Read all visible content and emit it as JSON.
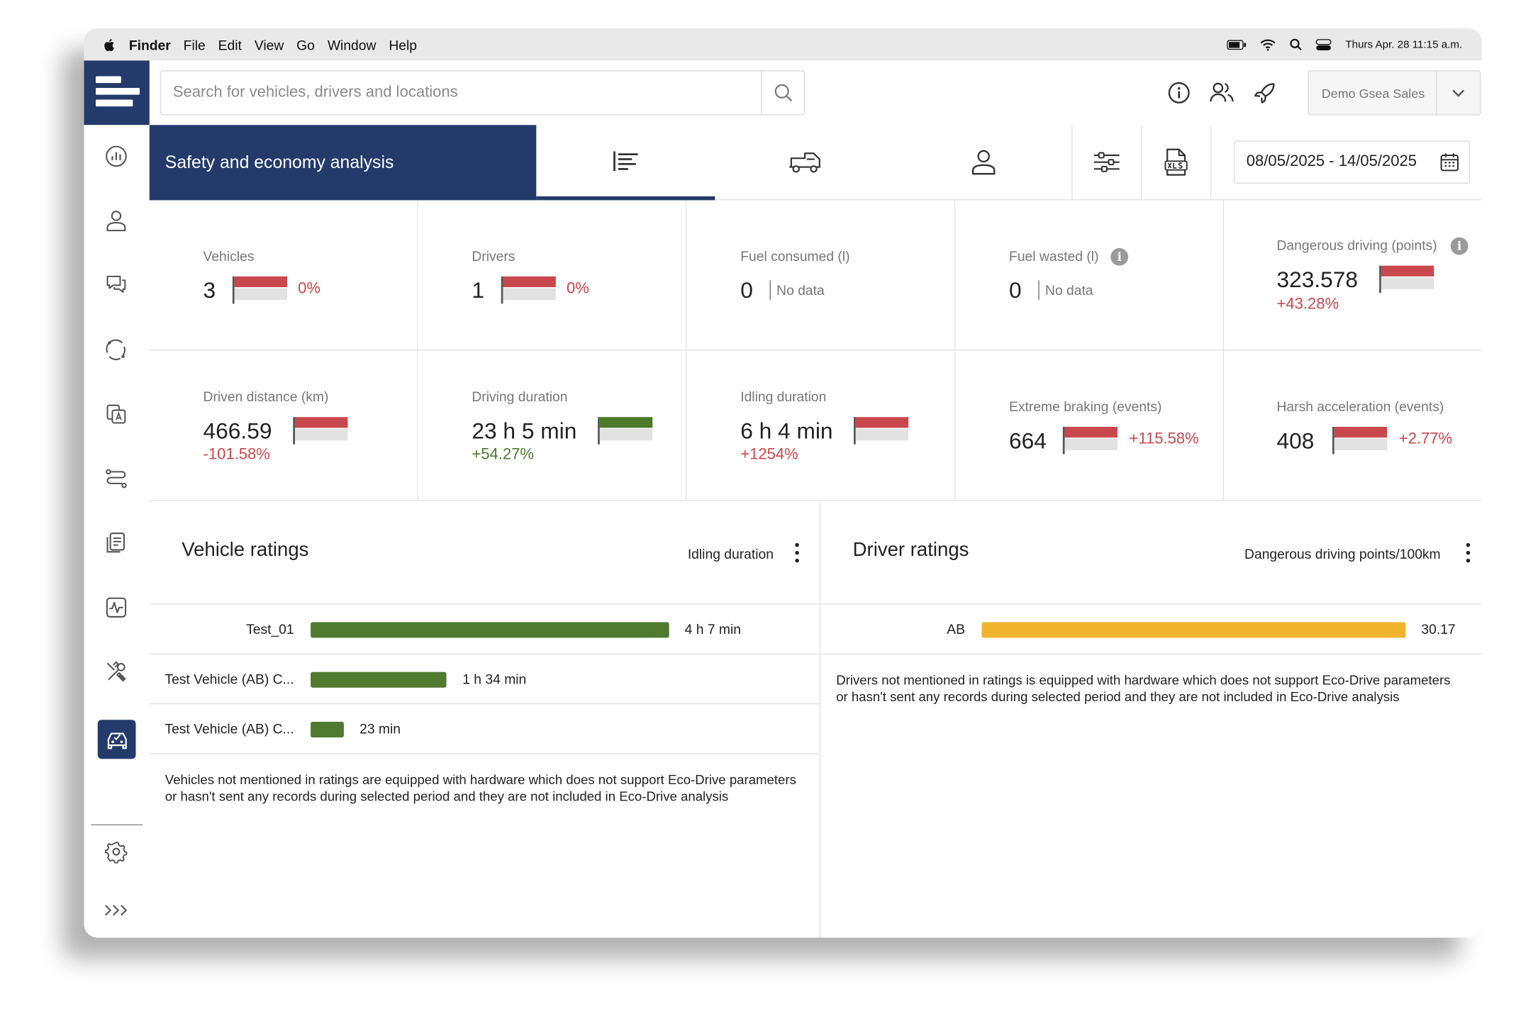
{
  "menubar": {
    "app": "Finder",
    "items": [
      "File",
      "Edit",
      "View",
      "Go",
      "Window",
      "Help"
    ],
    "clock": "Thurs Apr. 28 11:15 a.m.",
    "icons": [
      "apple-icon",
      "battery-icon",
      "wifi-icon",
      "spotlight-search-icon",
      "control-center-icon"
    ]
  },
  "header": {
    "search_placeholder": "Search for vehicles, drivers and locations",
    "account_name": "Demo Gsea Sales",
    "icons": [
      "info-icon",
      "users-icon",
      "rocket-icon",
      "chevron-down-icon"
    ]
  },
  "sidebar": {
    "icons": [
      "dashboard-icon",
      "person-icon",
      "chat-icon",
      "routes-icon",
      "documents-icon",
      "trips-icon",
      "reports-icon",
      "activity-icon",
      "tools-icon",
      "eco-drive-car-icon",
      "settings-icon",
      "expand-icon"
    ],
    "active": "eco-drive-car-icon"
  },
  "page": {
    "title": "Safety and economy analysis",
    "tabs": [
      "list-view-icon",
      "vehicles-icon",
      "drivers-icon"
    ],
    "active_tab": "list-view-icon",
    "tools": [
      "filters-icon",
      "xls-export-icon"
    ],
    "date_range": "08/05/2025 - 14/05/2025"
  },
  "colors": {
    "brand": "#233a6b",
    "negative": "#c9484d",
    "positive": "#4c7a2a",
    "vehicle_bar": "#4f7a2f",
    "driver_bar": "#f0b42d"
  },
  "kpis": [
    {
      "label": "Vehicles",
      "value": "3",
      "change": "0%",
      "trend": "negative",
      "flag_fill": 1.0
    },
    {
      "label": "Drivers",
      "value": "1",
      "change": "0%",
      "trend": "negative",
      "flag_fill": 1.0
    },
    {
      "label": "Fuel consumed (l)",
      "value": "0",
      "nodata": "No data"
    },
    {
      "label": "Fuel wasted (l)",
      "value": "0",
      "nodata": "No data",
      "info": "i"
    },
    {
      "label": "Dangerous driving (points)",
      "value": "323.578",
      "change": "+43.28%",
      "trend": "negative",
      "flag_fill": 1.0,
      "info": "i"
    },
    {
      "label": "Driven distance (km)",
      "value": "466.59",
      "change": "-101.58%",
      "trend": "negative",
      "flag_fill": 1.0
    },
    {
      "label": "Driving duration",
      "value": "23 h 5 min",
      "change": "+54.27%",
      "trend": "positive",
      "flag_fill": 1.0
    },
    {
      "label": "Idling duration",
      "value": "6 h 4 min",
      "change": "+1254%",
      "trend": "negative",
      "flag_fill": 1.0
    },
    {
      "label": "Extreme braking (events)",
      "value": "664",
      "change": "+115.58%",
      "trend": "negative",
      "flag_fill": 1.0
    },
    {
      "label": "Harsh acceleration (events)",
      "value": "408",
      "change": "+2.77%",
      "trend": "negative",
      "flag_fill": 1.0
    }
  ],
  "vehicle_ratings": {
    "title": "Vehicle ratings",
    "metric": "Idling duration",
    "rows": [
      {
        "label": "Test_01",
        "value": "4 h 7 min",
        "fraction": 1.0
      },
      {
        "label": "Test Vehicle (AB) C...",
        "value": "1 h 34 min",
        "fraction": 0.38
      },
      {
        "label": "Test Vehicle (AB) C...",
        "value": "23 min",
        "fraction": 0.093
      }
    ],
    "note": "Vehicles not mentioned in ratings are equipped with hardware which does not support Eco-Drive parameters or hasn't sent any records during selected period and they are not included in Eco-Drive analysis"
  },
  "driver_ratings": {
    "title": "Driver ratings",
    "metric": "Dangerous driving points/100km",
    "rows": [
      {
        "label": "AB",
        "value": "30.17",
        "fraction": 1.0
      }
    ],
    "note": "Drivers not mentioned in ratings is equipped with hardware which does not support Eco-Drive parameters or hasn't sent any records during selected period and they are not included in Eco-Drive analysis"
  }
}
